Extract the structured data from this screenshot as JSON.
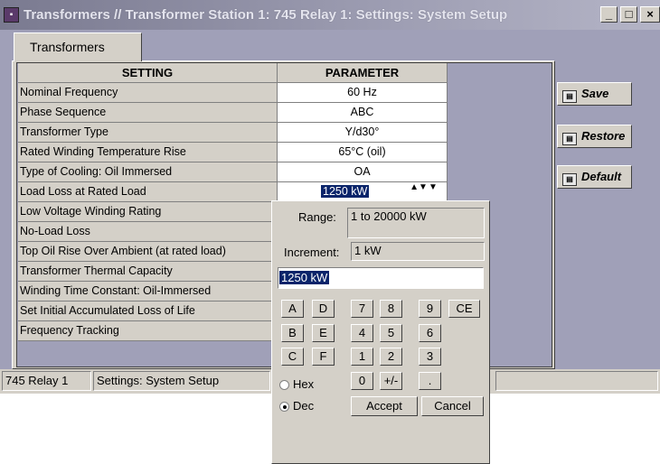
{
  "window": {
    "title": "Transformers // Transformer Station 1: 745 Relay 1: Settings: System Setup",
    "minimize": "_",
    "maximize": "□",
    "close": "×"
  },
  "tab": {
    "label": "Transformers"
  },
  "grid": {
    "headers": {
      "setting": "SETTING",
      "parameter": "PARAMETER"
    },
    "rows": [
      {
        "setting": "Nominal Frequency",
        "parameter": "60 Hz"
      },
      {
        "setting": "Phase Sequence",
        "parameter": "ABC"
      },
      {
        "setting": "Transformer Type",
        "parameter": "Y/d30°"
      },
      {
        "setting": "Rated Winding Temperature Rise",
        "parameter": "65°C (oil)"
      },
      {
        "setting": "Type of Cooling: Oil Immersed",
        "parameter": "OA"
      },
      {
        "setting": "Load Loss at Rated Load",
        "parameter": "1250 kW"
      },
      {
        "setting": "Low Voltage Winding Rating",
        "parameter": ""
      },
      {
        "setting": "No-Load Loss",
        "parameter": ""
      },
      {
        "setting": "Top Oil Rise Over Ambient (at rated load)",
        "parameter": ""
      },
      {
        "setting": "Transformer Thermal Capacity",
        "parameter": ""
      },
      {
        "setting": "Winding Time Constant: Oil-Immersed",
        "parameter": ""
      },
      {
        "setting": "Set Initial Accumulated Loss of Life",
        "parameter": ""
      },
      {
        "setting": "Frequency Tracking",
        "parameter": ""
      }
    ],
    "spinner_icon": "spin-up-down-icon",
    "spinner_arrow_icon": "dropdown-arrow-icon"
  },
  "buttons": {
    "save": "Save",
    "restore": "Restore",
    "default": "Default"
  },
  "status": {
    "device": "745 Relay 1",
    "screen": "Settings: System Setup"
  },
  "popup": {
    "range_label": "Range:",
    "range_value": "1 to 20000 kW",
    "increment_label": "Increment:",
    "increment_value": "1 kW",
    "entry_value": "1250 kW",
    "keys_hex": [
      "A",
      "D",
      "B",
      "E",
      "C",
      "F"
    ],
    "keys_num": [
      "7",
      "8",
      "9",
      "CE",
      "4",
      "5",
      "6",
      "1",
      "2",
      "3",
      "0",
      "+/-",
      "."
    ],
    "hex_label": "Hex",
    "dec_label": "Dec",
    "selected_mode": "Dec",
    "accept": "Accept",
    "cancel": "Cancel"
  }
}
